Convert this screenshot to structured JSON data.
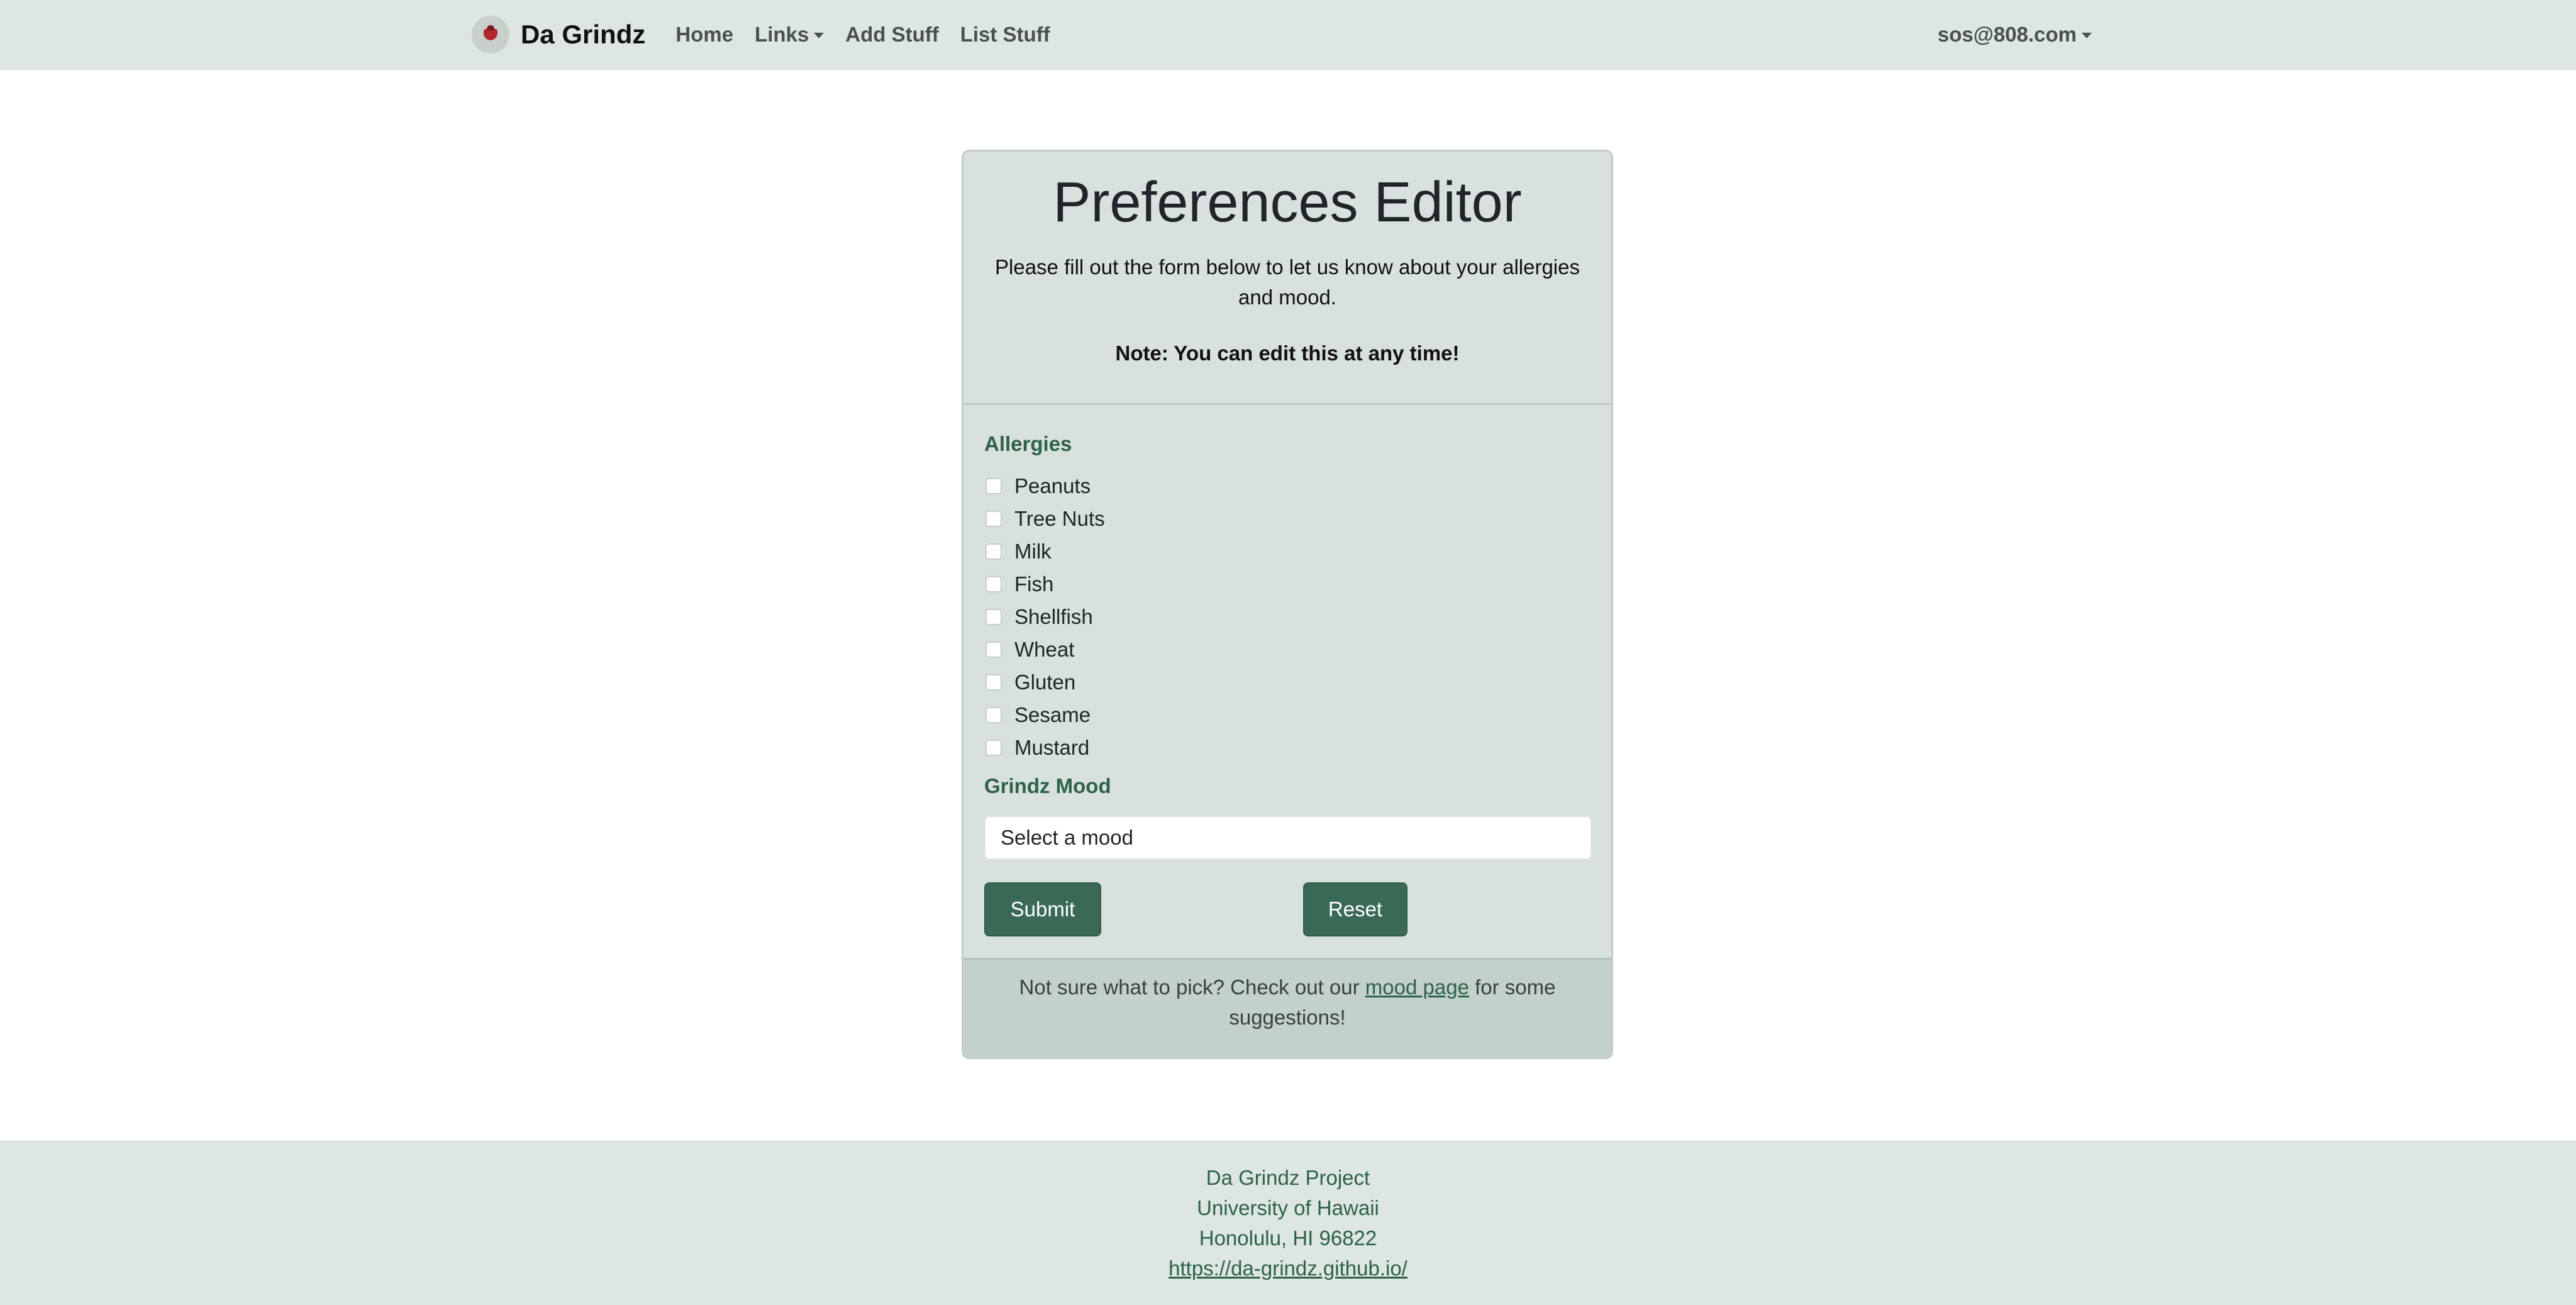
{
  "navbar": {
    "brand": "Da Grindz",
    "links": [
      {
        "label": "Home"
      },
      {
        "label": "Links"
      },
      {
        "label": "Add Stuff"
      },
      {
        "label": "List Stuff"
      }
    ],
    "user": "sos@808.com"
  },
  "card": {
    "title": "Preferences Editor",
    "description": "Please fill out the form below to let us know about your allergies and mood.",
    "note": "Note: You can edit this at any time!",
    "allergies_label": "Allergies",
    "allergies": [
      {
        "label": "Peanuts",
        "checked": false
      },
      {
        "label": "Tree Nuts",
        "checked": false
      },
      {
        "label": "Milk",
        "checked": false
      },
      {
        "label": "Fish",
        "checked": false
      },
      {
        "label": "Shellfish",
        "checked": false
      },
      {
        "label": "Wheat",
        "checked": false
      },
      {
        "label": "Gluten",
        "checked": false
      },
      {
        "label": "Sesame",
        "checked": false
      },
      {
        "label": "Mustard",
        "checked": false
      }
    ],
    "mood_label": "Grindz Mood",
    "mood_select": "Select a mood",
    "submit_label": "Submit",
    "reset_label": "Reset",
    "footer": {
      "before": "Not sure what to pick? Check out our ",
      "link": "mood page",
      "after": " for some suggestions!"
    }
  },
  "page_footer": {
    "lines": [
      "Da Grindz Project",
      "University of Hawaii",
      "Honolulu, HI 96822"
    ],
    "url": "https://da-grindz.github.io/"
  },
  "colors": {
    "nav_bg": "#dde6e1",
    "card_bg": "#d8e1dd",
    "accent_green": "#2e6249",
    "button_bg": "#3a6a56"
  }
}
